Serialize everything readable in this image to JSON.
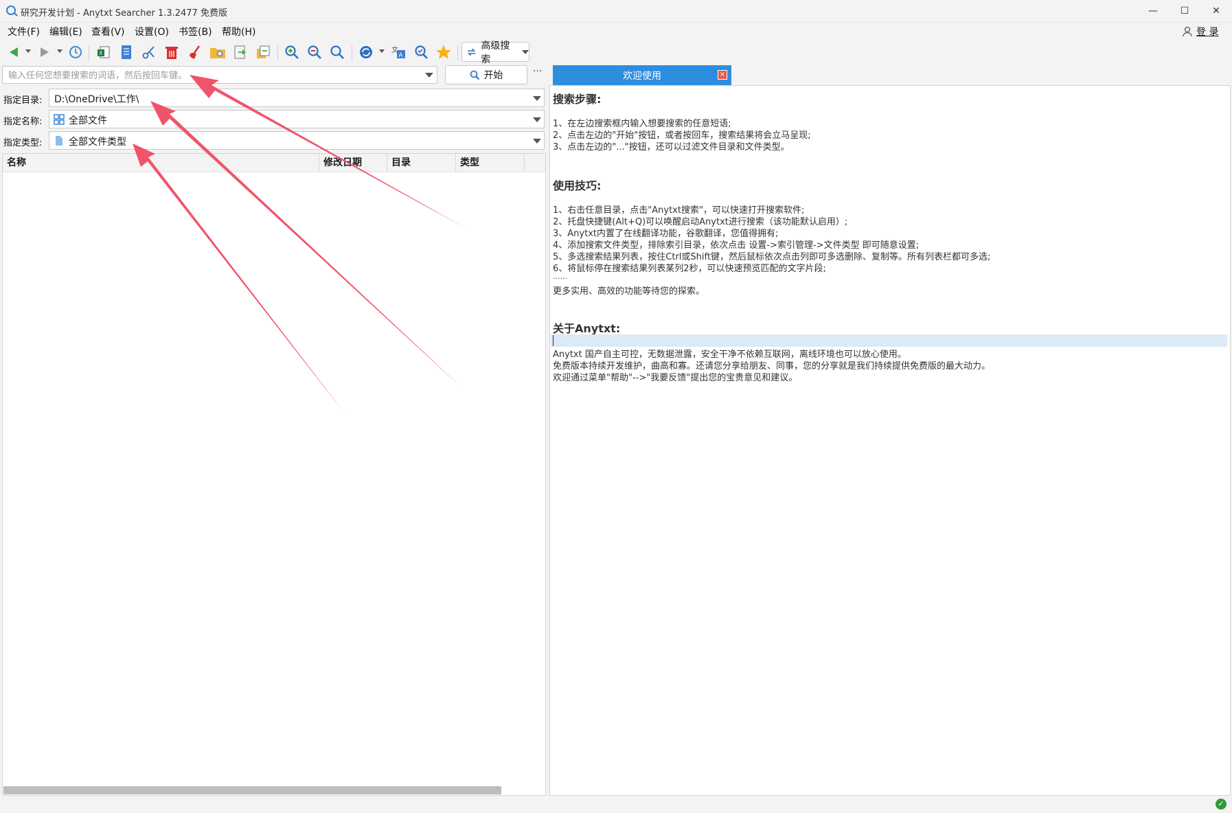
{
  "window": {
    "title": "研究开发计划 - Anytxt Searcher 1.3.2477 免费版",
    "minimize_glyph": "—",
    "maximize_glyph": "☐",
    "close_glyph": "✕"
  },
  "menu": {
    "items": [
      "文件(F)",
      "编辑(E)",
      "查看(V)",
      "设置(O)",
      "书签(B)",
      "帮助(H)"
    ],
    "login_label": "登 录"
  },
  "toolbar": {
    "advanced_search_label": "高级搜索",
    "icons": [
      "back-arrow-icon",
      "forward-arrow-icon",
      "history-icon",
      "excel-export-icon",
      "document-icon",
      "cut-icon",
      "delete-icon",
      "broom-icon",
      "open-folder-icon",
      "copy-to-icon",
      "move-to-icon",
      "zoom-in-icon",
      "zoom-out-icon",
      "search-zoom-icon",
      "refresh-icon",
      "translate-icon",
      "find-icon",
      "bookmark-star-icon",
      "advanced-search-icon"
    ]
  },
  "search": {
    "placeholder": "输入任何您想要搜索的词语，然后按回车键。",
    "start_label": "开始",
    "more_label": "···"
  },
  "filters": {
    "dir_label": "指定目录:",
    "dir_value": "D:\\OneDrive\\工作\\",
    "name_label": "指定名称:",
    "name_value": "全部文件",
    "type_label": "指定类型:",
    "type_value": "全部文件类型"
  },
  "results": {
    "columns": [
      "名称",
      "修改日期",
      "目录",
      "类型"
    ]
  },
  "welcome": {
    "tab_label": "欢迎使用",
    "tab_close": "×",
    "section1_title": "搜索步骤:",
    "section1_lines": [
      "1、在左边搜索框内输入想要搜索的任意短语;",
      "2、点击左边的\"开始\"按钮，或者按回车，搜索结果将会立马呈现;",
      "3、点击左边的\"...\"按钮，还可以过滤文件目录和文件类型。"
    ],
    "section2_title": "使用技巧:",
    "section2_lines": [
      "1、右击任意目录，点击\"Anytxt搜索\"，可以快速打开搜索软件;",
      "2、托盘快捷键(Alt+Q)可以唤醒启动Anytxt进行搜索（该功能默认启用）;",
      "3、Anytxt内置了在线翻译功能，谷歌翻译，您值得拥有;",
      "4、添加搜索文件类型，排除索引目录，依次点击 设置->索引管理->文件类型 即可随意设置;",
      "5、多选搜索结果列表，按住Ctrl或Shift键，然后鼠标依次点击列即可多选删除、复制等。所有列表栏都可多选;",
      "6、将鼠标停在搜索结果列表某列2秒，可以快速预览匹配的文字片段;",
      "......",
      "更多实用、高效的功能等待您的探索。"
    ],
    "section3_title": "关于Anytxt:",
    "section3_lines": [
      "Anytxt 国产自主可控，无数据泄露，安全干净不依赖互联网，离线环境也可以放心使用。",
      "免费版本持续开发维护，曲高和寡。还请您分享给朋友、同事，您的分享就是我们持续提供免费版的最大动力。",
      "欢迎通过菜单\"帮助\"-->\"我要反馈\"提出您的宝贵意见和建议。"
    ]
  },
  "colors": {
    "tab_blue": "#2d8ee0",
    "arrow_red": "#f0546a",
    "status_green": "#2f9a3a"
  }
}
